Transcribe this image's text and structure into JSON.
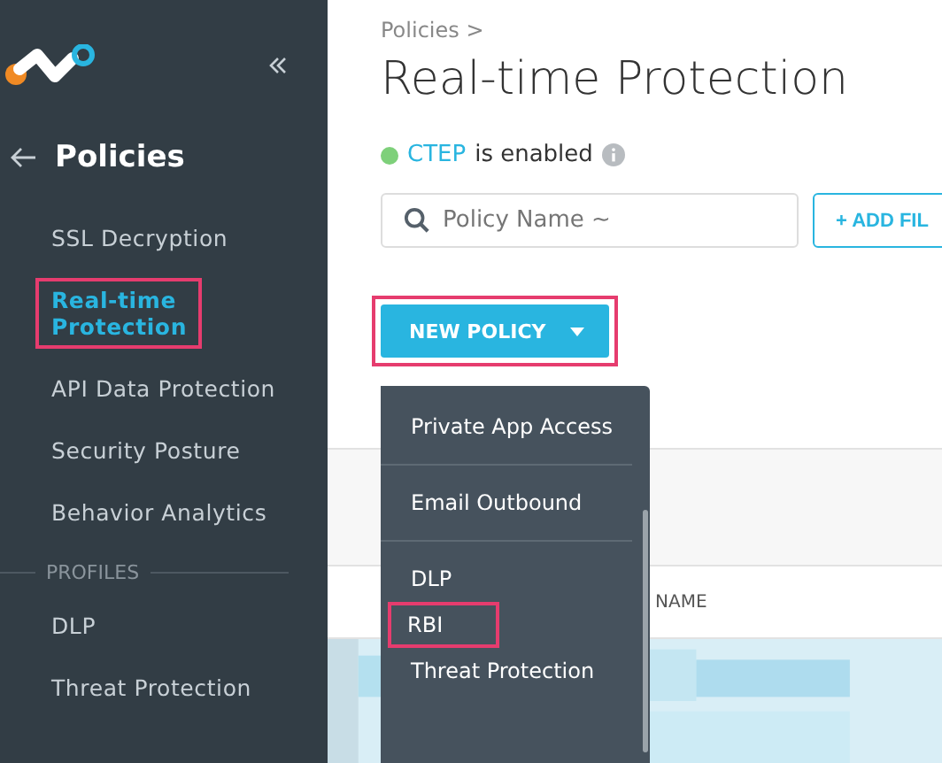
{
  "sidebar": {
    "back_title": "Policies",
    "items": [
      {
        "label": "SSL Decryption",
        "selected": false,
        "highlighted": false
      },
      {
        "label": "Real-time Protection",
        "selected": true,
        "highlighted": true
      },
      {
        "label": "API Data Protection",
        "selected": false,
        "highlighted": false
      },
      {
        "label": "Security Posture",
        "selected": false,
        "highlighted": false
      },
      {
        "label": "Behavior Analytics",
        "selected": false,
        "highlighted": false
      }
    ],
    "section": "PROFILES",
    "profile_items": [
      {
        "label": "DLP",
        "selected": false
      },
      {
        "label": "Threat Protection",
        "selected": false
      }
    ]
  },
  "breadcrumb": "Policies >",
  "title": "Real-time Protection",
  "status": {
    "name": "CTEP",
    "text": "is enabled",
    "color": "#7ed07a"
  },
  "search": {
    "placeholder": "Policy Name ~"
  },
  "add_filter": "+ ADD FIL",
  "new_policy": {
    "label": "NEW POLICY",
    "highlighted": true,
    "expanded": true
  },
  "menu": [
    {
      "label": "Private App Access",
      "divider": true,
      "highlighted": false
    },
    {
      "label": "Email Outbound",
      "divider": true,
      "highlighted": false
    },
    {
      "label": "DLP",
      "divider": false,
      "highlighted": false
    },
    {
      "label": "RBI",
      "divider": false,
      "highlighted": true
    },
    {
      "label": "Threat Protection",
      "divider": false,
      "highlighted": false
    }
  ],
  "table": {
    "columns": [
      "NAME"
    ]
  }
}
